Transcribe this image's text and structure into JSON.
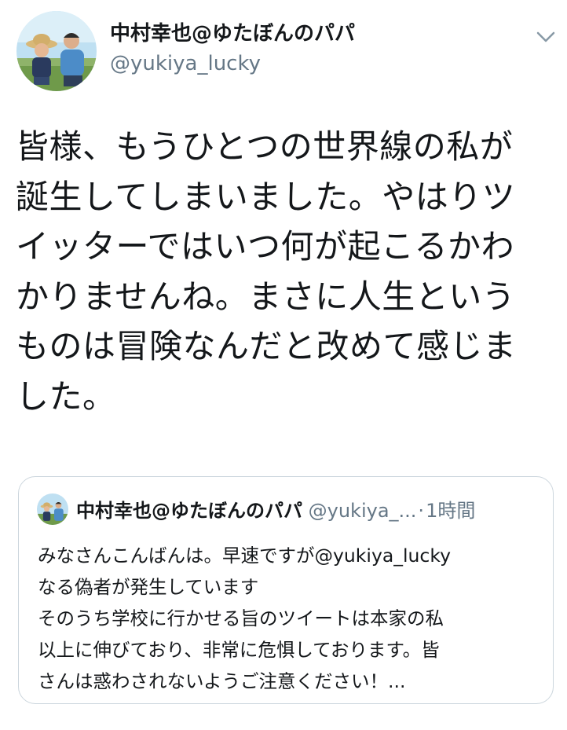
{
  "author": {
    "display_name": "中村幸也@ゆたぼんのパパ",
    "handle": "@yukiya_lucky"
  },
  "tweet": {
    "lines": [
      "皆様、もうひとつの世界線の私が",
      "誕生してしまいました。やはりツ",
      "イッターではいつ何が起こるかわ",
      "かりませんね。まさに人生という",
      "ものは冒険なんだと改めて感じま",
      "した。"
    ]
  },
  "quoted_tweet": {
    "display_name": "中村幸也@ゆたぼんのパパ",
    "handle": "@yukiya_...",
    "separator": "·",
    "time": "1時間",
    "lines": [
      "みなさんこんばんは。早速ですが@yukiya_lucky",
      "なる偽者が発生しています",
      "そのうち学校に行かせる旨のツイートは本家の私",
      "以上に伸びており、非常に危惧しております。皆",
      "さんは惑わされないようご注意ください！..."
    ]
  },
  "icons": {
    "menu": "chevron-down-icon"
  },
  "colors": {
    "text": "#14171a",
    "secondary": "#657786",
    "border": "#ccd6dd"
  }
}
